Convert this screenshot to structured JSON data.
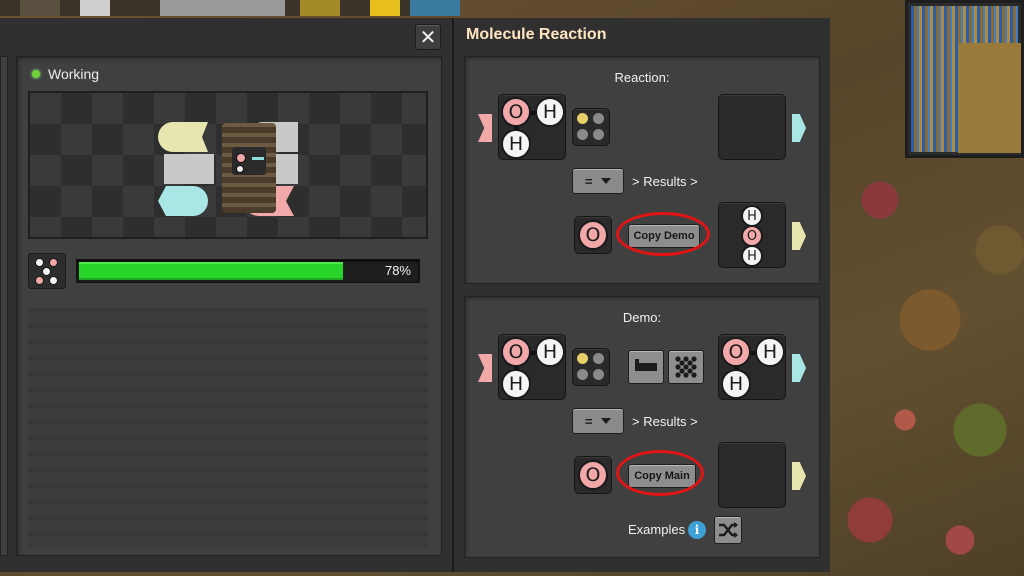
{
  "window": {
    "close_glyph": "✕",
    "status": {
      "label": "Working",
      "color": "#6fd23a"
    },
    "progress": {
      "value": 0.78,
      "label": "78%",
      "fill_color": "#28d42a"
    }
  },
  "right_panel": {
    "title": "Molecule Reaction",
    "reaction": {
      "heading": "Reaction:",
      "operator_select": "=",
      "results_label": "> Results >",
      "single_atom": "O",
      "copy_button": "Copy Demo",
      "input_molecule": {
        "atoms": [
          "O",
          "H",
          "H"
        ]
      },
      "output_molecule": {
        "atoms": [
          "H",
          "O",
          "H"
        ]
      }
    },
    "demo": {
      "heading": "Demo:",
      "operator_select": "=",
      "results_label": "> Results >",
      "single_atom": "O",
      "copy_button": "Copy Main",
      "examples_label": "Examples",
      "info_glyph": "i",
      "input_molecule": {
        "atoms": [
          "O",
          "H",
          "H"
        ]
      },
      "output_molecule": {
        "atoms": [
          "O",
          "H",
          "H"
        ]
      }
    }
  },
  "colors": {
    "oxygen": "#f2a8a8",
    "hydrogen": "#f4f4f4",
    "input_arrow": "#f1a9a9",
    "output_arrow_cyan": "#a9e6e6",
    "output_arrow_yellow": "#e7e6b0",
    "highlight": "#e01414",
    "title": "#ffe6c0"
  }
}
